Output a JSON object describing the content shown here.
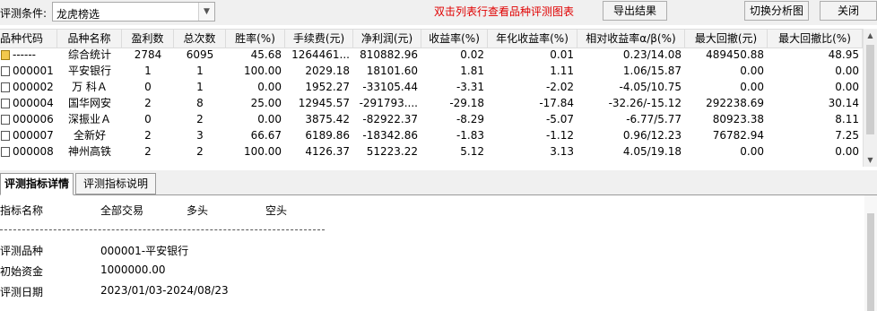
{
  "toolbar": {
    "condition_label": "评测条件:",
    "condition_value": "龙虎榜选",
    "hint": "双击列表行查看品种评测图表",
    "export_label": "导出结果",
    "switch_label": "切换分析图",
    "close_label": "关闭"
  },
  "table": {
    "headers": [
      "品种代码",
      "品种名称",
      "盈利数",
      "总次数",
      "胜率(%)",
      "手续费(元)",
      "净利润(元)",
      "收益率(%)",
      "年化收益率(%)",
      "相对收益率α/β(%)",
      "最大回撤(元)",
      "最大回撤比(%)"
    ],
    "rows": [
      [
        "------",
        "综合统计",
        "2784",
        "6095",
        "45.68",
        "1264461...",
        "810882.96",
        "0.02",
        "0.01",
        "0.23/14.08",
        "489450.88",
        "48.95"
      ],
      [
        "000001",
        "平安银行",
        "1",
        "1",
        "100.00",
        "2029.18",
        "18101.60",
        "1.81",
        "1.11",
        "1.06/15.87",
        "0.00",
        "0.00"
      ],
      [
        "000002",
        "万 科Ａ",
        "0",
        "1",
        "0.00",
        "1952.27",
        "-33105.44",
        "-3.31",
        "-2.02",
        "-4.05/10.75",
        "0.00",
        "0.00"
      ],
      [
        "000004",
        "国华网安",
        "2",
        "8",
        "25.00",
        "12945.57",
        "-291793....",
        "-29.18",
        "-17.84",
        "-32.26/-15.12",
        "292238.69",
        "30.14"
      ],
      [
        "000006",
        "深振业Ａ",
        "0",
        "2",
        "0.00",
        "3875.42",
        "-82922.37",
        "-8.29",
        "-5.07",
        "-6.77/5.77",
        "80923.38",
        "8.11"
      ],
      [
        "000007",
        "全新好",
        "2",
        "3",
        "66.67",
        "6189.86",
        "-18342.86",
        "-1.83",
        "-1.12",
        "0.96/12.23",
        "76782.94",
        "7.25"
      ],
      [
        "000008",
        "神州高铁",
        "2",
        "2",
        "100.00",
        "4126.37",
        "51223.22",
        "5.12",
        "3.13",
        "4.05/19.18",
        "0.00",
        "0.00"
      ]
    ]
  },
  "tabs": [
    "评测指标详情",
    "评测指标说明"
  ],
  "detail": {
    "headers": [
      "指标名称",
      "全部交易",
      "多头",
      "空头"
    ],
    "rows": [
      {
        "label": "评测品种",
        "value": "000001-平安银行"
      },
      {
        "label": "初始资金",
        "value": "1000000.00"
      },
      {
        "label": "评测日期",
        "value": "2023/01/03-2024/08/23"
      }
    ]
  }
}
